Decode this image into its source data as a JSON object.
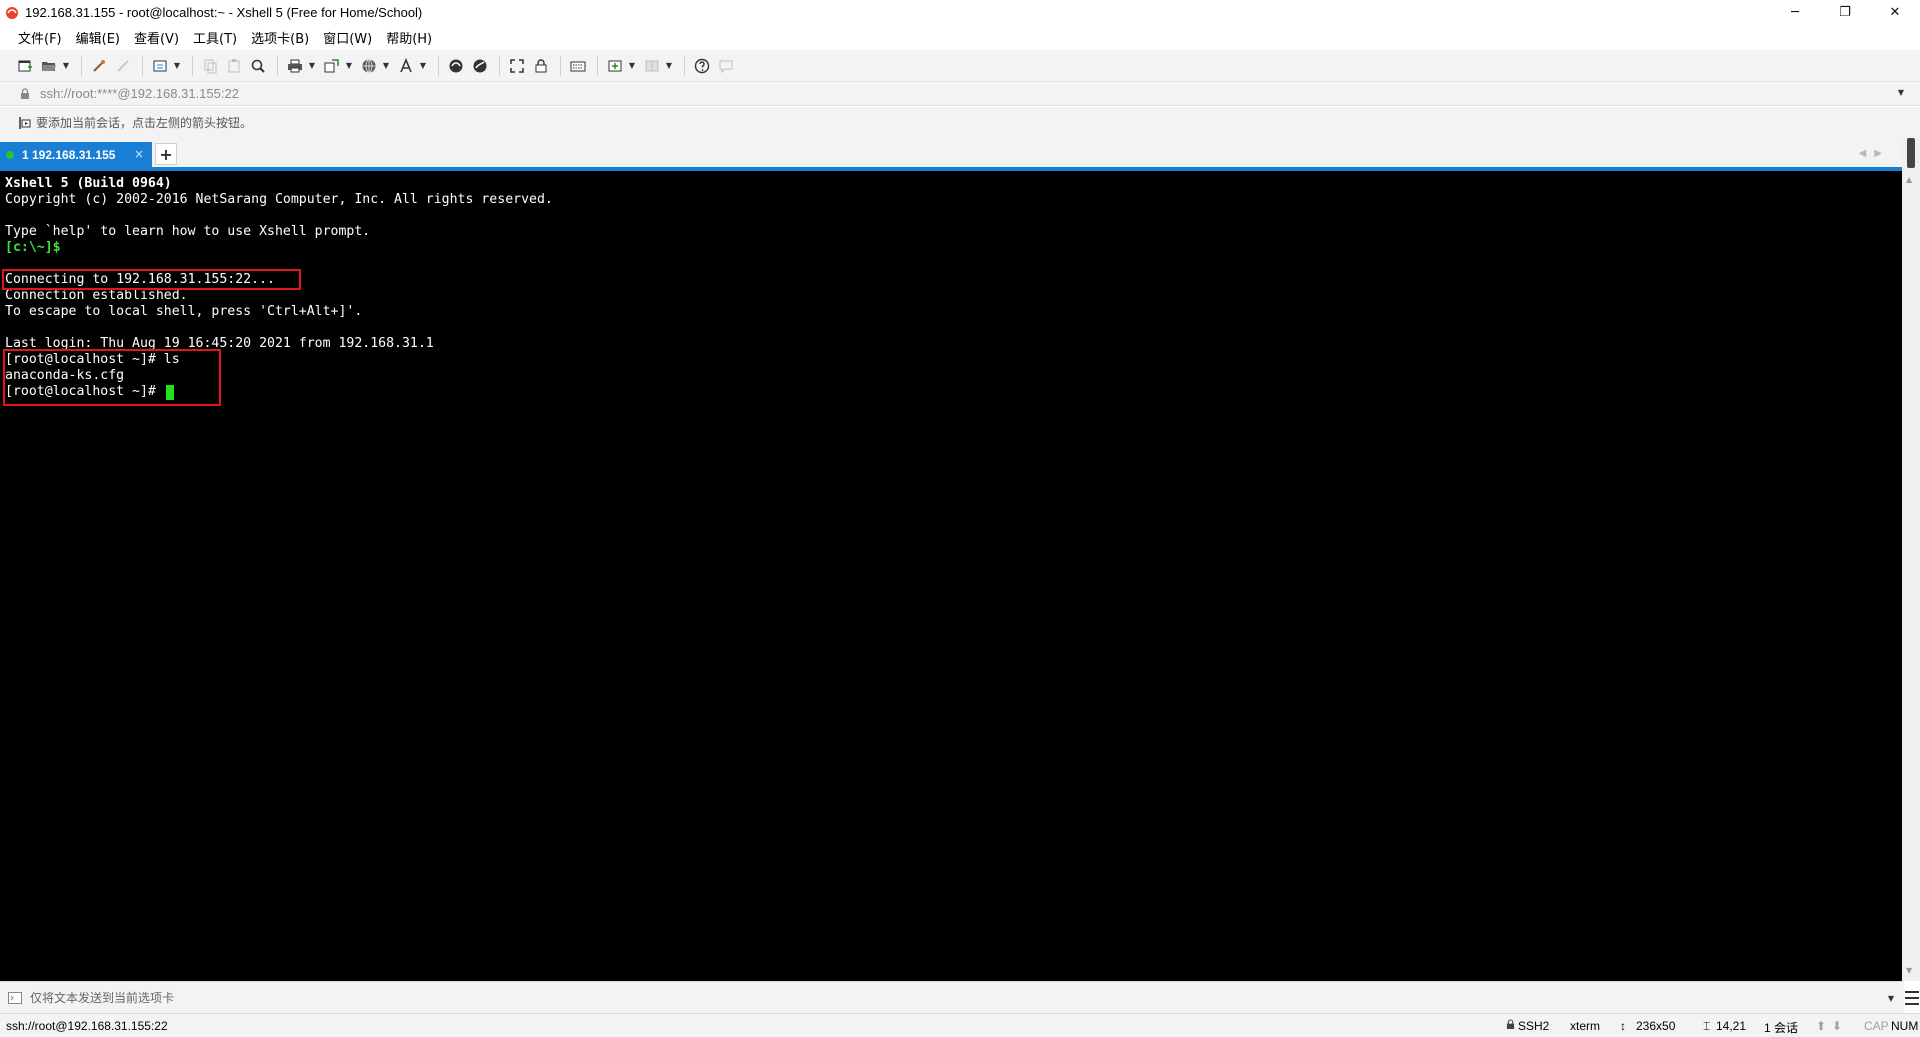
{
  "window": {
    "title": "192.168.31.155 - root@localhost:~ - Xshell 5 (Free for Home/School)",
    "minimize": "─",
    "restore": "❐",
    "close": "✕"
  },
  "menu": {
    "items": [
      "文件(F)",
      "编辑(E)",
      "查看(V)",
      "工具(T)",
      "选项卡(B)",
      "窗口(W)",
      "帮助(H)"
    ]
  },
  "address": {
    "value": "ssh://root:****@192.168.31.155:22"
  },
  "hint": {
    "text": "要添加当前会话，点击左侧的箭头按钮。"
  },
  "tabs": {
    "active_label": "1 192.168.31.155",
    "close": "×",
    "add": "+"
  },
  "terminal": {
    "lines": [
      {
        "text": "Xshell 5 (Build 0964)",
        "style": "bold"
      },
      {
        "text": "Copyright (c) 2002-2016 NetSarang Computer, Inc. All rights reserved.",
        "style": ""
      },
      {
        "text": "",
        "style": ""
      },
      {
        "text": "Type `help' to learn how to use Xshell prompt.",
        "style": ""
      },
      {
        "text": "[c:\\~]$",
        "style": "green"
      },
      {
        "text": "",
        "style": ""
      },
      {
        "text": "Connecting to 192.168.31.155:22...",
        "style": ""
      },
      {
        "text": "Connection established.",
        "style": ""
      },
      {
        "text": "To escape to local shell, press 'Ctrl+Alt+]'.",
        "style": ""
      },
      {
        "text": "",
        "style": ""
      },
      {
        "text": "Last login: Thu Aug 19 16:45:20 2021 from 192.168.31.1",
        "style": ""
      },
      {
        "text": "[root@localhost ~]# ls",
        "style": ""
      },
      {
        "text": "anaconda-ks.cfg",
        "style": ""
      },
      {
        "text": "[root@localhost ~]# ",
        "style": ""
      }
    ]
  },
  "compose": {
    "text": "仅将文本发送到当前选项卡"
  },
  "status": {
    "connection": "ssh://root@192.168.31.155:22",
    "protocol": "SSH2",
    "terminal_type": "xterm",
    "size": "236x50",
    "cursor_pos": "14,21",
    "sessions": "1 会话",
    "caps": "CAP",
    "num": "NUM"
  },
  "colors": {
    "tab_active": "#1a7fd4",
    "terminal_bg": "#000000",
    "prompt_green": "#3ee03e",
    "highlight_red": "#e0151d"
  }
}
